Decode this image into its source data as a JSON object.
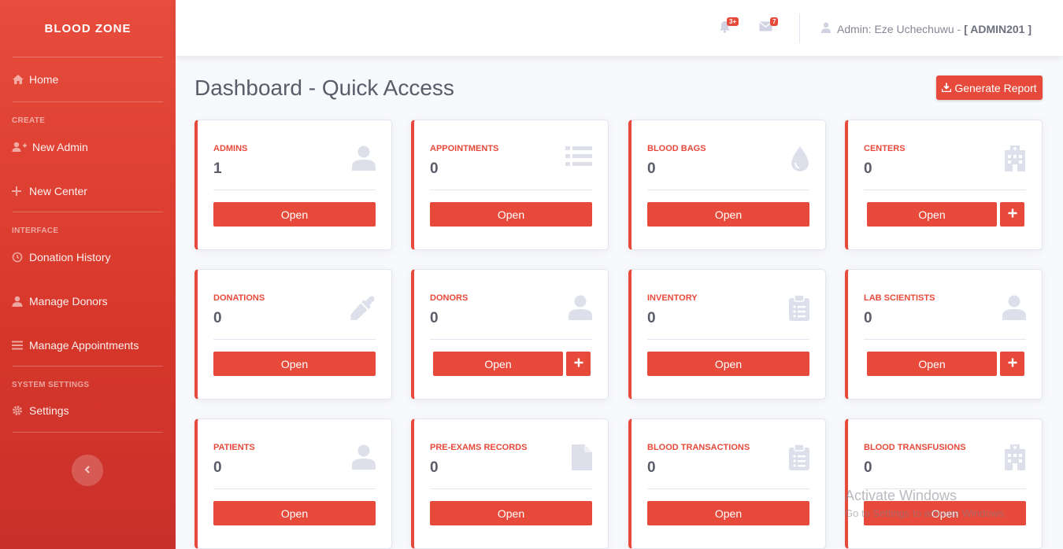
{
  "brand": "BLOOD ZONE",
  "sidebar": {
    "home": "Home",
    "heading_create": "CREATE",
    "new_admin": "New Admin",
    "new_center": "New Center",
    "heading_interface": "INTERFACE",
    "donation_history": "Donation History",
    "manage_donors": "Manage Donors",
    "manage_appointments": "Manage Appointments",
    "heading_system": "SYSTEM SETTINGS",
    "settings": "Settings"
  },
  "topbar": {
    "alerts_badge": "3+",
    "messages_badge": "7",
    "user_label": "Admin: Eze Uchechuwu -",
    "user_id": "[ ADMIN201 ]"
  },
  "page": {
    "title": "Dashboard - Quick Access",
    "generate_report": "Generate Report"
  },
  "cards": [
    {
      "title": "ADMINS",
      "value": "1",
      "button": "Open",
      "icon": "user-icon"
    },
    {
      "title": "APPOINTMENTS",
      "value": "0",
      "button": "Open",
      "icon": "list-icon"
    },
    {
      "title": "BLOOD BAGS",
      "value": "0",
      "button": "Open",
      "icon": "droplet-icon"
    },
    {
      "title": "CENTERS",
      "value": "0",
      "button": "Open",
      "icon": "hospital-icon"
    },
    {
      "title": "DONATIONS",
      "value": "0",
      "button": "Open",
      "icon": "eyedropper-icon"
    },
    {
      "title": "DONORS",
      "value": "0",
      "button": "Open",
      "icon": "user-icon"
    },
    {
      "title": "INVENTORY",
      "value": "0",
      "button": "Open",
      "icon": "clipboard-icon"
    },
    {
      "title": "LAB SCIENTISTS",
      "value": "0",
      "button": "Open",
      "icon": "user-icon"
    },
    {
      "title": "PATIENTS",
      "value": "0",
      "button": "Open",
      "icon": "user-icon"
    },
    {
      "title": "PRE-EXAMS RECORDS",
      "value": "0",
      "button": "Open",
      "icon": "file-icon"
    },
    {
      "title": "BLOOD TRANSACTIONS",
      "value": "0",
      "button": "Open",
      "icon": "clipboard-icon"
    },
    {
      "title": "BLOOD TRANSFUSIONS",
      "value": "0",
      "button": "Open",
      "icon": "hospital-icon"
    }
  ],
  "watermark": {
    "line1": "Activate Windows",
    "line2": "Go to Settings to activate Windows."
  },
  "colors": {
    "accent": "#e74a3b",
    "sidebar": "#e74c3c",
    "text": "#5a5c69",
    "icon_muted": "#dddfeb"
  }
}
